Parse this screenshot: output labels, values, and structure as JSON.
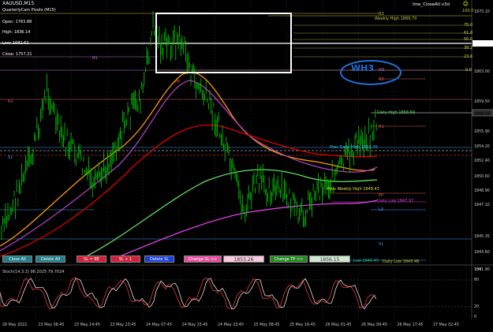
{
  "window": {
    "symbol_label": "XAUUSD,M15",
    "subtitle": "QuarterlyCam Pivots (M15)",
    "ohlc": [
      {
        "label": "Open: 1763.88"
      },
      {
        "label": "High: 1836.14"
      },
      {
        "label": "Low: 1682.62"
      },
      {
        "label": "Close: 1757.21"
      }
    ],
    "ea_label": "Ime_CloseAll v3d",
    "smile_icon": "smile-icon",
    "wh3_label": "WH3"
  },
  "level_labels": {
    "r3": "R3",
    "r2": "R2",
    "r1": "R1",
    "h3": "H3",
    "pp": "PP",
    "l3": "L3",
    "s1": "S1",
    "weekly_high": "Weekly High 1869.70",
    "daily_high": "Daily High 1858.69",
    "prev_daily_high": "Prev Daily High 1853.70",
    "prev_weekly_high": "Prev Weekly High 1849.43",
    "daily_low": "Daily Low 1847.97",
    "weekly_low": "Low 1846.43",
    "daily_low_2": "Daily Low 1843.46",
    "fib_100": "100.0",
    "fib_75": "75.0",
    "fib_61": "61.8",
    "fib_50": "50.0",
    "fib_38": "38.2",
    "fib_23": "23.6",
    "fib_0": "0.0",
    "left_r1": "R1",
    "left_r2": "R2",
    "left_s1": "S1",
    "left_pp": "PP"
  },
  "price_axis": [
    "1870.10",
    "1866.60",
    "1863.00",
    "1859.50",
    "1858.39",
    "1855.90",
    "1854.20",
    "1852.40",
    "1850.60",
    "1848.90",
    "1847.10",
    "1845.35",
    "1843.60",
    "1841.90"
  ],
  "time_axis": [
    "26 May 2022",
    "23 May 06:45",
    "23 May 14:45",
    "23 May 23:45",
    "24 May 07:45",
    "24 May 15:45",
    "24 May 23:45",
    "25 May 08:45",
    "25 May 16:45",
    "26 May 01:45",
    "26 May 09:45",
    "26 May 17:45",
    "27 May 02:45"
  ],
  "buttons": {
    "close_all": "Close All",
    "delete_all": "Delete All",
    "sl_be": "SL = BE",
    "sl_plus_1": "SL + 1",
    "delete_sl": "Delete SL",
    "change_sl": "Change SL >>",
    "sl_value": "1853.26",
    "change_tp": "Change TP >>",
    "tp_value": "1856.15"
  },
  "indicator": {
    "label": "Stoch(14,3,3) 96.2025 79.7024",
    "axis": [
      "100",
      "80",
      "20",
      "0"
    ]
  },
  "colors": {
    "background": "#000000",
    "candles": "#00c000",
    "ma_orange": "#ff9900",
    "ma_purple": "#b040c0",
    "ma_red": "#e00000",
    "ma_green": "#60e060",
    "ma_magenta": "#e040e0",
    "close_all_btn": "#1e7f8a",
    "delete_all_btn": "#1e7f8a",
    "sl_be_btn": "#d0213a",
    "sl_plus_btn": "#d0213a",
    "delete_sl_btn": "#1a3ed8",
    "change_sl_btn": "#e94ba0",
    "change_tp_btn": "#1f8a1f",
    "wh3_ellipse": "#1f6ed6"
  }
}
